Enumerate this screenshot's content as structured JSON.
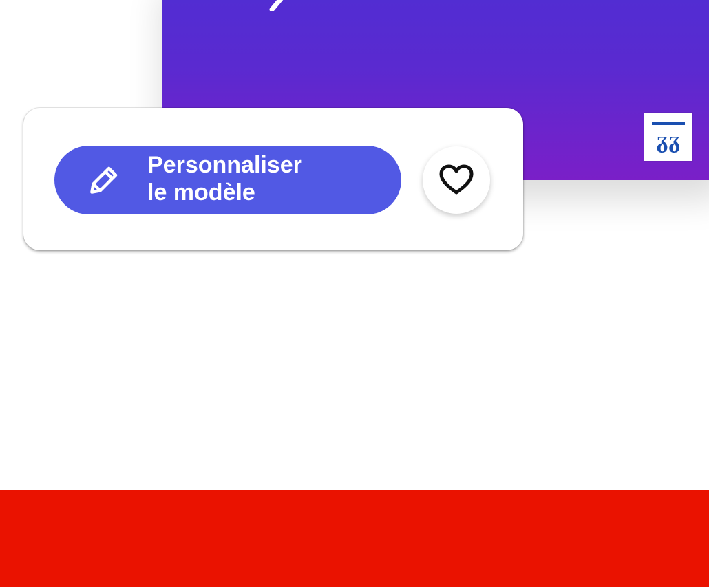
{
  "colors": {
    "page_background": "#ffffff",
    "card_gradient_top": "#4f2ed3",
    "card_gradient_bottom": "#7a1fc8",
    "customize_button": "#5159e4",
    "footer_band": "#ea1200",
    "brand_blue": "#1a4fb0"
  },
  "action_panel": {
    "customize_button": {
      "label": "Personnaliser\nle modèle",
      "icon": "pencil-icon"
    },
    "favorite_button": {
      "icon": "heart-icon"
    }
  },
  "template_card": {
    "brand_icon": "brand-logo-icon"
  }
}
